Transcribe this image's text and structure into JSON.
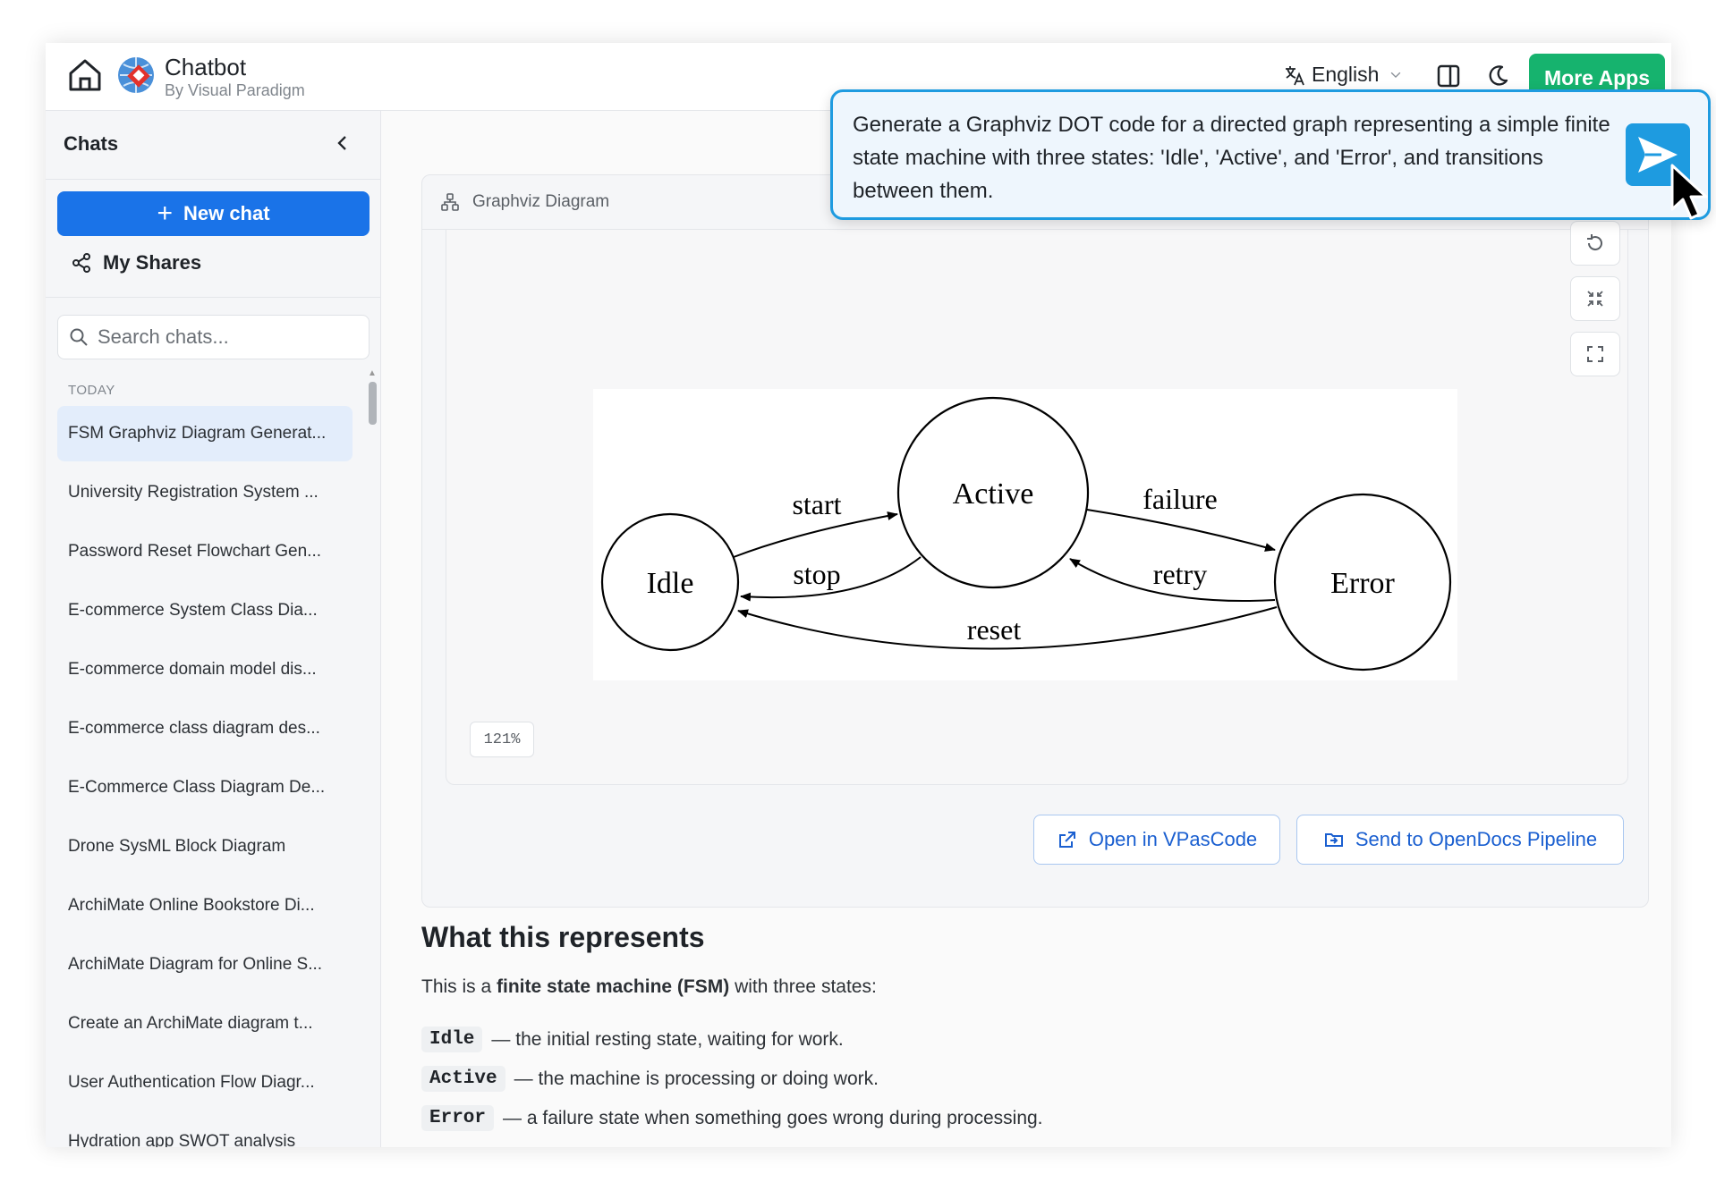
{
  "header": {
    "brand_title": "Chatbot",
    "brand_subtitle": "By Visual Paradigm",
    "language": "English",
    "more_apps": "More Apps"
  },
  "sidebar": {
    "title": "Chats",
    "new_chat": "New chat",
    "my_shares": "My Shares",
    "search_placeholder": "Search chats...",
    "section": "TODAY",
    "chats": [
      "FSM Graphviz Diagram Generat...",
      "University Registration System ...",
      "Password Reset Flowchart Gen...",
      "E-commerce System Class Dia...",
      "E-commerce domain model dis...",
      "E-commerce class diagram des...",
      "E-Commerce Class Diagram De...",
      "Drone SysML Block Diagram",
      "ArchiMate Online Bookstore Di...",
      "ArchiMate Diagram for Online S...",
      "Create an ArchiMate diagram t...",
      "User Authentication Flow Diagr...",
      "Hydration app SWOT analysis"
    ]
  },
  "diagram": {
    "title": "Graphviz Diagram",
    "zoom": "121%",
    "nodes": {
      "idle": "Idle",
      "active": "Active",
      "error": "Error"
    },
    "edges": {
      "start": "start",
      "stop": "stop",
      "failure": "failure",
      "retry": "retry",
      "reset": "reset"
    },
    "open_button": "Open in VPasCode",
    "send_button": "Send to OpenDocs Pipeline"
  },
  "explanation": {
    "heading": "What this represents",
    "intro_pre": "This is a ",
    "intro_bold": "finite state machine (FSM)",
    "intro_post": " with three states:",
    "states": [
      {
        "name": "Idle",
        "desc": "— the initial resting state, waiting for work."
      },
      {
        "name": "Active",
        "desc": "— the machine is processing or doing work."
      },
      {
        "name": "Error",
        "desc": "— a failure state when something goes wrong during processing."
      }
    ]
  },
  "prompt": {
    "text": "Generate a Graphviz DOT code for a directed graph representing a simple finite state machine with three states: 'Idle', 'Active', and 'Error', and transitions between them."
  },
  "colors": {
    "accent_blue": "#1a73e8",
    "green": "#16b36e",
    "prompt_border": "#1e9be0"
  }
}
